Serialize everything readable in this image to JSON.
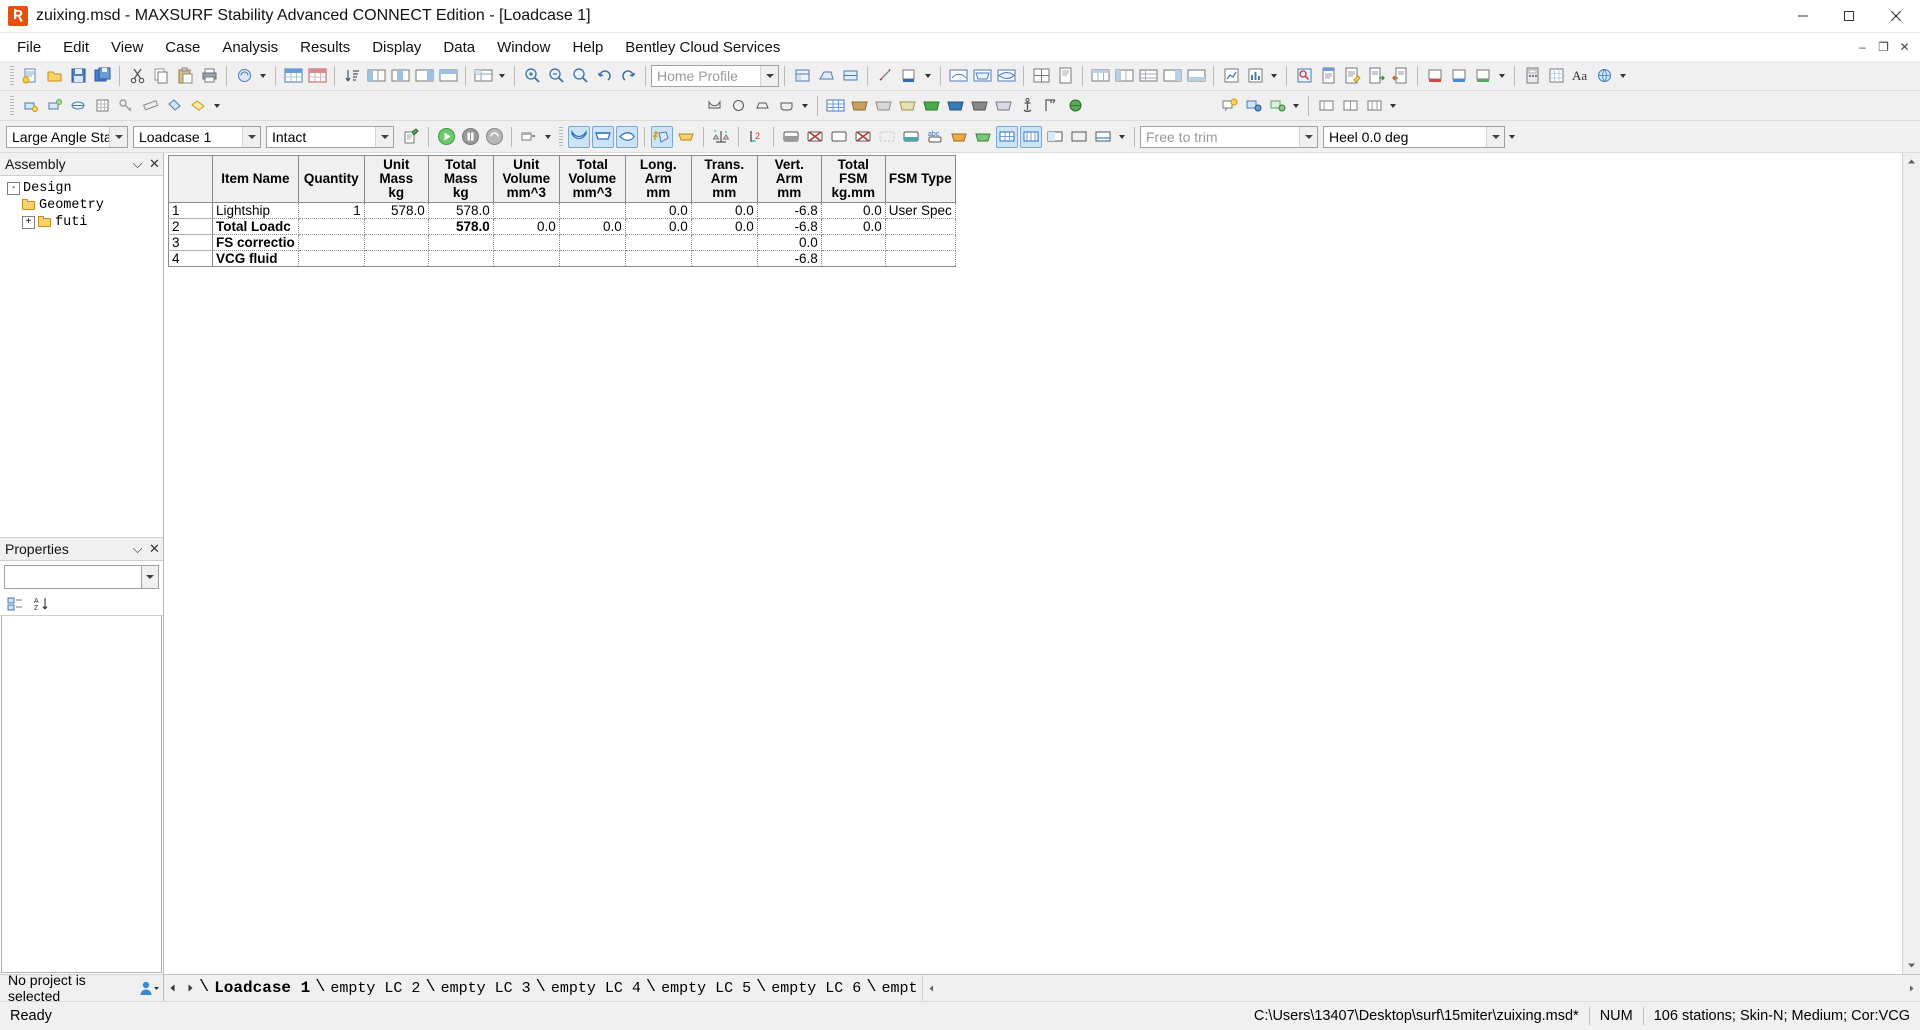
{
  "window": {
    "title": "zuixing.msd - MAXSURF Stability Advanced CONNECT Edition - [Loadcase 1]",
    "app_icon": "maxsurf-icon",
    "minimize": "─",
    "maximize": "□",
    "close": "✕",
    "doc_restore": "–",
    "doc_maximize": "❐",
    "doc_close": "✕"
  },
  "menubar": {
    "items": [
      {
        "label": "File",
        "name": "menu-file"
      },
      {
        "label": "Edit",
        "name": "menu-edit"
      },
      {
        "label": "View",
        "name": "menu-view"
      },
      {
        "label": "Case",
        "name": "menu-case"
      },
      {
        "label": "Analysis",
        "name": "menu-analysis"
      },
      {
        "label": "Results",
        "name": "menu-results"
      },
      {
        "label": "Display",
        "name": "menu-display"
      },
      {
        "label": "Data",
        "name": "menu-data"
      },
      {
        "label": "Window",
        "name": "menu-window"
      },
      {
        "label": "Help",
        "name": "menu-help"
      },
      {
        "label": "Bentley Cloud Services",
        "name": "menu-bentley-cloud-services"
      }
    ]
  },
  "toolbar_profile": {
    "value": "Home Profile",
    "name": "profile-combo"
  },
  "analysis_bar": {
    "analysis_type": "Large Angle Stab",
    "loadcase": "Loadcase 1",
    "condition": "Intact",
    "trim_mode": "Free to trim",
    "heel": "Heel 0.0 deg"
  },
  "sidebar": {
    "assembly": {
      "title": "Assembly",
      "pin": "⌵",
      "close": "✕",
      "tree": [
        {
          "label": "Design",
          "expander": "-",
          "level": 0,
          "type": "root"
        },
        {
          "label": "Geometry",
          "level": 1,
          "type": "folder"
        },
        {
          "label": "futi",
          "expander": "+",
          "level": 1,
          "type": "folder"
        }
      ]
    },
    "properties": {
      "title": "Properties",
      "pin": "⌵",
      "close": "✕",
      "selected_value": "",
      "categorize_icon": "categorize-icon",
      "sort-az_icon": "sort-alpha-icon"
    },
    "footer": {
      "text": "No project is selected",
      "user_icon": "user-icon"
    }
  },
  "grid": {
    "columns": [
      {
        "label": "",
        "key": "rownum",
        "align": "left"
      },
      {
        "label": "Item Name",
        "key": "item_name",
        "align": "left"
      },
      {
        "label": "Quantity",
        "key": "quantity",
        "align": "right"
      },
      {
        "label": "Unit Mass\nkg",
        "key": "unit_mass",
        "align": "right"
      },
      {
        "label": "Total Mass\nkg",
        "key": "total_mass",
        "align": "right"
      },
      {
        "label": "Unit Volume\nmm^3",
        "key": "unit_volume",
        "align": "right"
      },
      {
        "label": "Total Volume\nmm^3",
        "key": "total_volume",
        "align": "right"
      },
      {
        "label": "Long. Arm\nmm",
        "key": "long_arm",
        "align": "right"
      },
      {
        "label": "Trans. Arm\nmm",
        "key": "trans_arm",
        "align": "right"
      },
      {
        "label": "Vert. Arm\nmm",
        "key": "vert_arm",
        "align": "right"
      },
      {
        "label": "Total FSM\nkg.mm",
        "key": "total_fsm",
        "align": "right"
      },
      {
        "label": "FSM Type",
        "key": "fsm_type",
        "align": "left"
      }
    ],
    "column_headers": {
      "item_name": "Item Name",
      "quantity": "Quantity",
      "unit_mass_l1": "Unit Mass",
      "unit_mass_l2": "kg",
      "total_mass_l1": "Total Mass",
      "total_mass_l2": "kg",
      "unit_volume_l1": "Unit Volume",
      "unit_volume_l2": "mm^3",
      "total_volume_l1": "Total",
      "total_volume_l2": "Volume",
      "total_volume_l3": "mm^3",
      "long_arm_l1": "Long. Arm",
      "long_arm_l2": "mm",
      "trans_arm_l1": "Trans. Arm",
      "trans_arm_l2": "mm",
      "vert_arm_l1": "Vert. Arm",
      "vert_arm_l2": "mm",
      "total_fsm_l1": "Total FSM",
      "total_fsm_l2": "kg.mm",
      "fsm_type": "FSM Type"
    },
    "rows": [
      {
        "rownum": "1",
        "item_name": "Lightship",
        "bold": false,
        "quantity": "1",
        "unit_mass": "578.0",
        "total_mass": "578.0",
        "unit_volume": "",
        "total_volume": "",
        "long_arm": "0.0",
        "trans_arm": "0.0",
        "vert_arm": "-6.8",
        "total_fsm": "0.0",
        "fsm_type": "User Spec"
      },
      {
        "rownum": "2",
        "item_name": "Total Loadc",
        "bold": true,
        "quantity": "",
        "unit_mass": "",
        "total_mass": "578.0",
        "unit_volume": "0.0",
        "total_volume": "0.0",
        "long_arm": "0.0",
        "trans_arm": "0.0",
        "vert_arm": "-6.8",
        "total_fsm": "0.0",
        "fsm_type": ""
      },
      {
        "rownum": "3",
        "item_name": "FS correctio",
        "bold": true,
        "quantity": "",
        "unit_mass": "",
        "total_mass": "",
        "unit_volume": "",
        "total_volume": "",
        "long_arm": "",
        "trans_arm": "",
        "vert_arm": "0.0",
        "total_fsm": "",
        "fsm_type": ""
      },
      {
        "rownum": "4",
        "item_name": "VCG fluid",
        "bold": true,
        "quantity": "",
        "unit_mass": "",
        "total_mass": "",
        "unit_volume": "",
        "total_volume": "",
        "long_arm": "",
        "trans_arm": "",
        "vert_arm": "-6.8",
        "total_fsm": "",
        "fsm_type": ""
      }
    ]
  },
  "tabs": {
    "items": [
      {
        "label": "Loadcase 1",
        "active": true
      },
      {
        "label": "empty LC 2",
        "active": false
      },
      {
        "label": "empty LC 3",
        "active": false
      },
      {
        "label": "empty LC 4",
        "active": false
      },
      {
        "label": "empty LC 5",
        "active": false
      },
      {
        "label": "empty LC 6",
        "active": false
      },
      {
        "label": "empt",
        "active": false
      }
    ],
    "nav_first": "◀",
    "nav_last": "▶"
  },
  "statusbar": {
    "ready": "Ready",
    "file_path": "C:\\Users\\13407\\Desktop\\surf\\15miter\\zuixing.msd*",
    "num": "NUM",
    "stations": "106 stations; Skin-N; Medium; Cor:VCG"
  }
}
